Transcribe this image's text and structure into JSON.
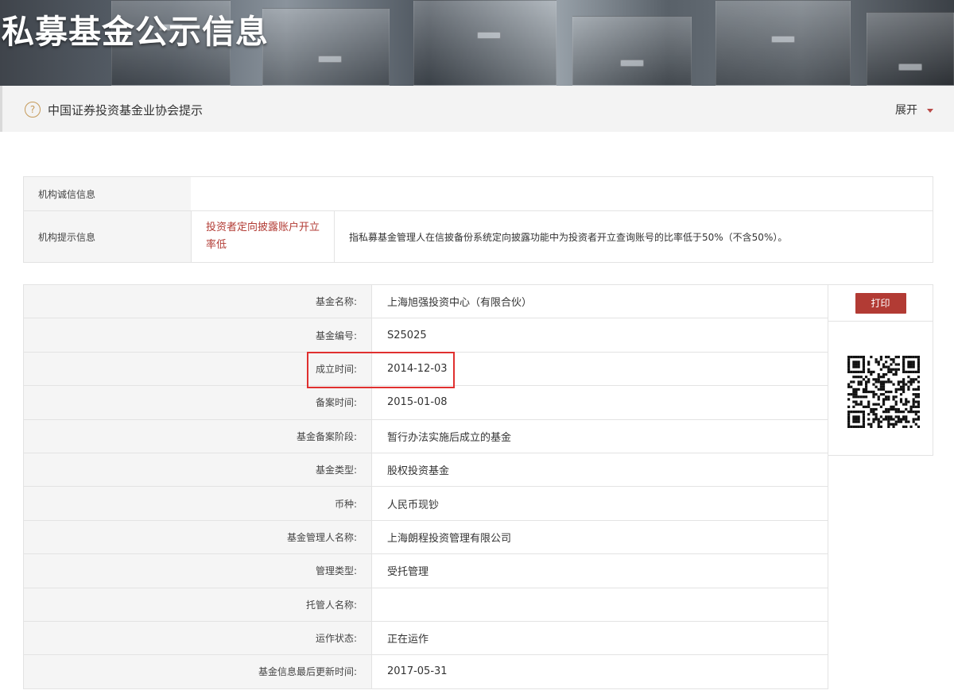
{
  "banner": {
    "title": "私募基金公示信息"
  },
  "notice": {
    "text": "中国证券投资基金业协会提示",
    "toggle_label": "展开",
    "icon": "question-circle-icon"
  },
  "institution": {
    "row1_label": "机构诚信信息",
    "row2_label": "机构提示信息",
    "row2_tag": "投资者定向披露账户开立率低",
    "row2_desc": "指私募基金管理人在信披备份系统定向披露功能中为投资者开立查询账号的比率低于50%（不含50%）。"
  },
  "fund": {
    "print_label": "打印",
    "rows": [
      {
        "label": "基金名称:",
        "value": "上海旭强投资中心（有限合伙）"
      },
      {
        "label": "基金编号:",
        "value": "S25025"
      },
      {
        "label": "成立时间:",
        "value": "2014-12-03"
      },
      {
        "label": "备案时间:",
        "value": "2015-01-08"
      },
      {
        "label": "基金备案阶段:",
        "value": "暂行办法实施后成立的基金"
      },
      {
        "label": "基金类型:",
        "value": "股权投资基金"
      },
      {
        "label": "币种:",
        "value": "人民币现钞"
      },
      {
        "label": "基金管理人名称:",
        "value": "上海朗程投资管理有限公司"
      },
      {
        "label": "管理类型:",
        "value": "受托管理"
      },
      {
        "label": "托管人名称:",
        "value": ""
      },
      {
        "label": "运作状态:",
        "value": "正在运作"
      },
      {
        "label": "基金信息最后更新时间:",
        "value": "2017-05-31"
      }
    ]
  },
  "colors": {
    "accent_red": "#b23b34",
    "highlight_red": "#e0302f",
    "label_bg": "#f5f5f5"
  }
}
